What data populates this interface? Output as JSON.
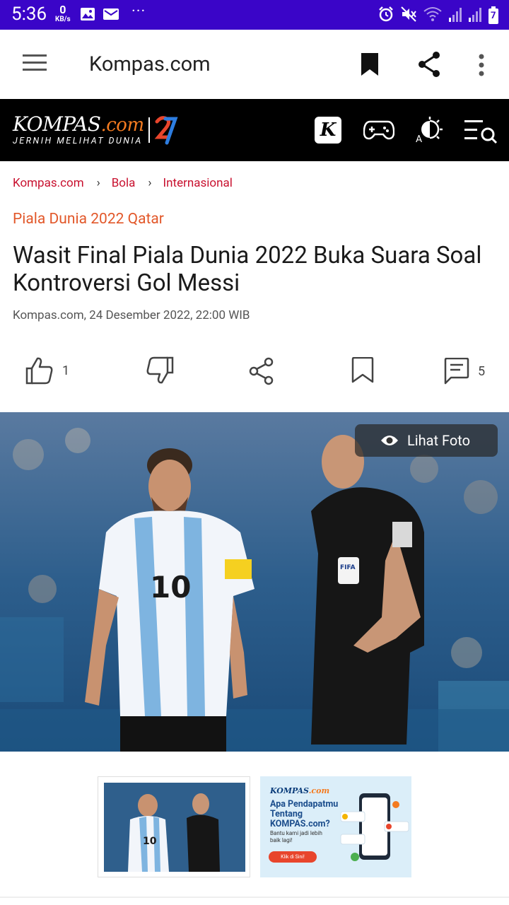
{
  "status_bar": {
    "time": "5:36",
    "net_speed_value": "0",
    "net_speed_unit": "KB/s",
    "more": "···",
    "battery_level": "7"
  },
  "app_bar": {
    "title": "Kompas.com"
  },
  "kompas_header": {
    "logo_main": "KOMPAS",
    "logo_dotcom": ".com",
    "tagline": "JERNIH MELIHAT DUNIA",
    "badge": "27",
    "k_button": "K",
    "font_size_label": "A"
  },
  "breadcrumb": {
    "items": [
      "Kompas.com",
      "Bola",
      "Internasional"
    ],
    "separator": "›"
  },
  "article": {
    "category": "Piala Dunia 2022 Qatar",
    "title": "Wasit Final Piala Dunia 2022 Buka Suara Soal Kontroversi Gol Messi",
    "meta": "Kompas.com, 24 Desember 2022, 22:00 WIB"
  },
  "actions": {
    "like_count": "1",
    "comment_count": "5"
  },
  "hero": {
    "view_photo_label": "Lihat Foto",
    "player_number": "10",
    "badge_text": "FIFA"
  },
  "ad": {
    "brand": "KOMPAS",
    "brand_dotcom": ".com",
    "title": "Apa Pendapatmu Tentang KOMPAS.com?",
    "subtitle": "Bantu kami jadi lebih baik lagi!",
    "cta": "Klik di Sini!"
  },
  "colors": {
    "status_bar": "#3a05c8",
    "link_red": "#c8102e",
    "category_orange": "#e2582a",
    "header_black": "#000000"
  }
}
